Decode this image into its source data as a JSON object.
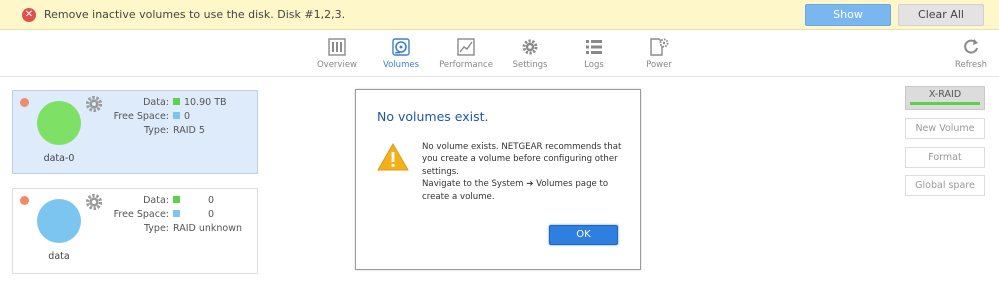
{
  "alert": {
    "icon": "error-circle-icon",
    "message": "Remove inactive volumes to use the disk. Disk #1,2,3.",
    "show_label": "Show",
    "clear_label": "Clear All",
    "colors": {
      "background": "#fdf7c9",
      "show_button": "#7ab6ef",
      "error": "#e0504c"
    }
  },
  "nav": {
    "items": [
      {
        "label": "Overview",
        "icon": "overview-icon"
      },
      {
        "label": "Volumes",
        "icon": "volumes-disk-icon",
        "active": true
      },
      {
        "label": "Performance",
        "icon": "performance-graph-icon"
      },
      {
        "label": "Settings",
        "icon": "gear-icon"
      },
      {
        "label": "Logs",
        "icon": "list-icon"
      },
      {
        "label": "Power",
        "icon": "power-doc-gear-icon"
      }
    ],
    "refresh_label": "Refresh",
    "active_color": "#3a7fd0"
  },
  "volumes": [
    {
      "name": "data-0",
      "selected": true,
      "disk_color": "#7ee065",
      "data_label": "Data:",
      "data_value": "10.90 TB",
      "free_label": "Free Space:",
      "free_value": "0",
      "type_label": "Type:",
      "type_value": "RAID 5"
    },
    {
      "name": "data",
      "selected": false,
      "disk_color": "#7cc5f0",
      "data_label": "Data:",
      "data_value": "0",
      "free_label": "Free Space:",
      "free_value": "0",
      "type_label": "Type:",
      "type_value": "RAID unknown"
    }
  ],
  "dialog": {
    "title": "No volumes exist.",
    "icon": "warning-triangle-icon",
    "message_line1": "No volume exists. NETGEAR recommends that you create a volume before configuring other settings.",
    "message_line2": "Navigate to the System ➔ Volumes page to create a volume.",
    "ok_label": "OK"
  },
  "side_actions": {
    "xraid_label": "X-RAID",
    "new_volume_label": "New Volume",
    "format_label": "Format",
    "global_spare_label": "Global spare"
  }
}
